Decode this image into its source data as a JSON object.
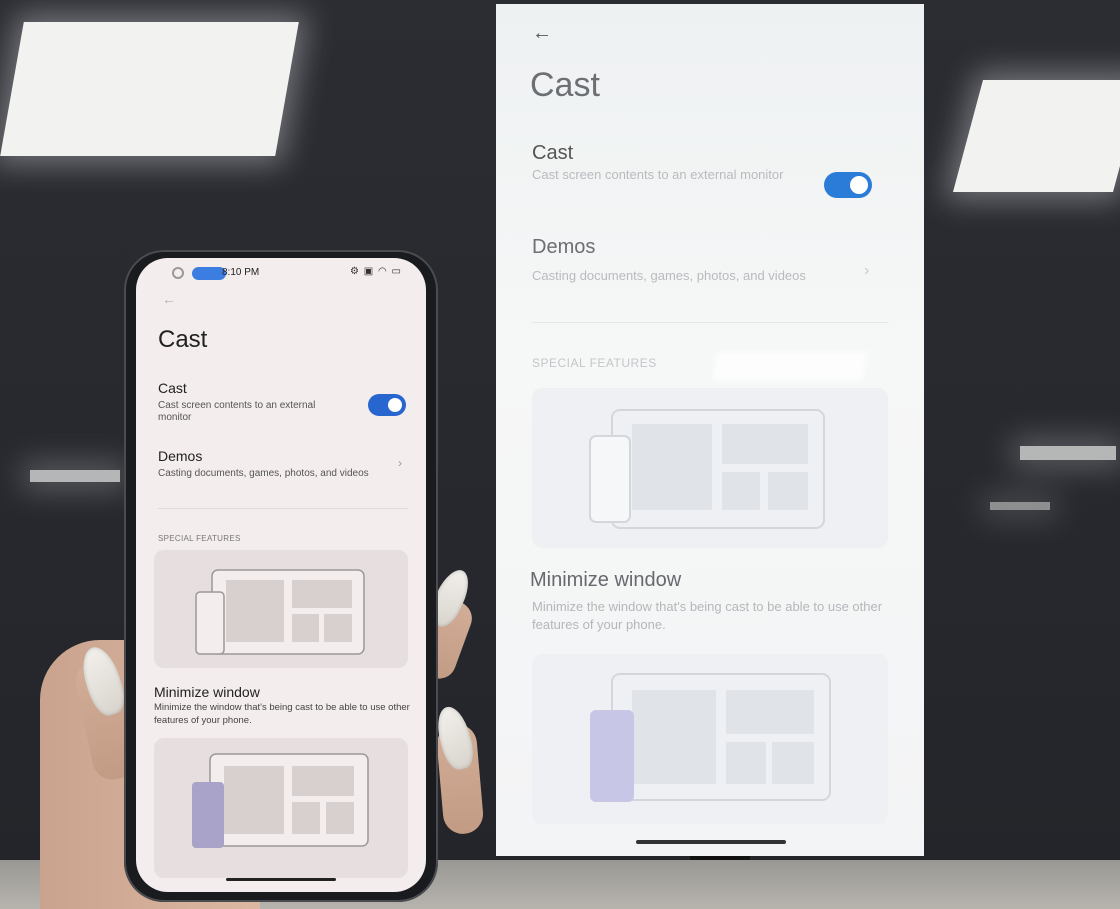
{
  "phone": {
    "status_time": "8:10 PM",
    "back_icon": "arrow-left-icon",
    "title": "Cast",
    "cast": {
      "heading": "Cast",
      "description": "Cast screen contents to an external monitor",
      "enabled": true
    },
    "demos": {
      "heading": "Demos",
      "description": "Casting documents, games, photos, and videos"
    },
    "section_label": "SPECIAL FEATURES",
    "minimize": {
      "heading": "Minimize window",
      "description": "Minimize the window that's being cast to be able to use other features of your phone."
    }
  },
  "tv": {
    "back_icon": "arrow-left-icon",
    "title": "Cast",
    "cast": {
      "heading": "Cast",
      "description": "Cast screen contents to an external monitor",
      "enabled": true
    },
    "demos": {
      "heading": "Demos",
      "description": "Casting documents, games, photos, and videos"
    },
    "section_label": "SPECIAL FEATURES",
    "minimize": {
      "heading": "Minimize window",
      "description": "Minimize the window that's being cast to be able to use other features of your phone."
    }
  },
  "colors": {
    "toggle_on": "#2766cf",
    "tv_toggle_on": "#2b7bd8"
  }
}
